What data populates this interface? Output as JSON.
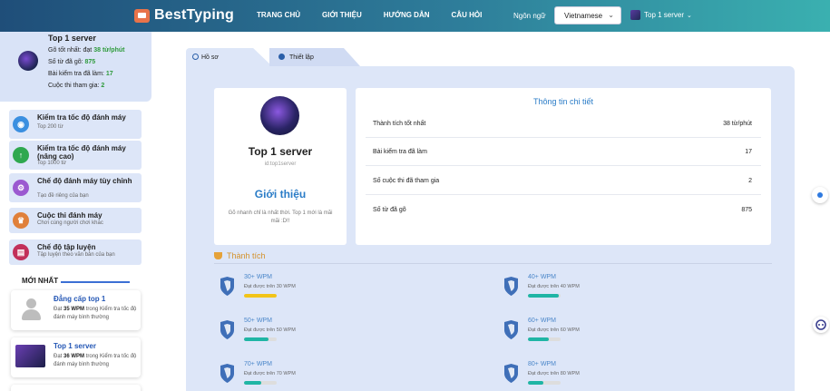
{
  "header": {
    "logo": "BestTyping",
    "nav": [
      "TRANG CHỦ",
      "GIỚI THIỆU",
      "HƯỚNG DẪN",
      "CÂU HỎI"
    ],
    "language_label": "Ngôn ngữ",
    "language_value": "Vietnamese",
    "user_name": "Top 1 server"
  },
  "sidebar": {
    "profile": {
      "name": "Top 1 server",
      "best_label": "Gõ tốt nhất: đạt",
      "best_value": "38 từ/phút",
      "words_label": "Số từ đã gõ:",
      "words_value": "875",
      "tests_label": "Bài kiểm tra đã làm:",
      "tests_value": "17",
      "contests_label": "Cuộc thi tham gia:",
      "contests_value": "2"
    },
    "menu": [
      {
        "title": "Kiểm tra tốc độ đánh máy",
        "sub": "Top 200 từ",
        "color": "#3b8fe0",
        "icon": "gauge-icon"
      },
      {
        "title": "Kiểm tra tốc độ đánh máy (nâng cao)",
        "sub": "Top 1000 từ",
        "color": "#2fa84f",
        "icon": "arrow-up-icon"
      },
      {
        "title": "Chế độ đánh máy tùy chỉnh",
        "sub": "Tạo đề riêng của bạn",
        "color": "#9b59d0",
        "icon": "gears-icon"
      },
      {
        "title": "Cuộc thi đánh máy",
        "sub": "Chơi cùng người chơi khác",
        "color": "#e0803a",
        "icon": "trophy-icon"
      },
      {
        "title": "Chế độ tập luyện",
        "sub": "Tập luyện theo văn bản của bạn",
        "color": "#c2305a",
        "icon": "keyboard-icon"
      }
    ],
    "newest_label": "MỚI NHẤT",
    "feed": [
      {
        "name": "Đẳng cấp top 1",
        "pre": "Đạt",
        "wpm": "35 WPM",
        "post": "trong Kiểm tra tốc độ đánh máy bình thường"
      },
      {
        "name": "Top 1 server",
        "pre": "Đạt",
        "wpm": "36 WPM",
        "post": "trong Kiểm tra tốc độ đánh máy bình thường"
      }
    ]
  },
  "tabs": [
    "Hồ sơ",
    "Thiết lập"
  ],
  "profile_card": {
    "name": "Top 1 server",
    "id": "id:top1server",
    "about_title": "Giới thiệu",
    "about_text": "Gõ nhanh chỉ là nhất thời. Top 1 mới là mãi mãi :D!!"
  },
  "details": {
    "title": "Thông tin chi tiết",
    "rows": [
      {
        "label": "Thành tích tốt nhất",
        "value": "38 từ/phút"
      },
      {
        "label": "Bài kiểm tra đã làm",
        "value": "17"
      },
      {
        "label": "Số cuộc thi đã tham gia",
        "value": "2"
      },
      {
        "label": "Số từ đã gõ",
        "value": "875"
      }
    ]
  },
  "achievements": {
    "title": "Thành tích",
    "items": [
      {
        "title": "30+ WPM",
        "sub": "Đạt được trên 30 WPM",
        "progress": 1.0,
        "color": "#f2c418"
      },
      {
        "title": "40+ WPM",
        "sub": "Đạt được trên 40 WPM",
        "progress": 0.95,
        "color": "#1fb5a5"
      },
      {
        "title": "50+ WPM",
        "sub": "Đạt được trên 50 WPM",
        "progress": 0.76,
        "color": "#1fb5a5"
      },
      {
        "title": "60+ WPM",
        "sub": "Đạt được trên 60 WPM",
        "progress": 0.63,
        "color": "#1fb5a5"
      },
      {
        "title": "70+ WPM",
        "sub": "Đạt được trên 70 WPM",
        "progress": 0.54,
        "color": "#1fb5a5"
      },
      {
        "title": "80+ WPM",
        "sub": "Đạt được trên 80 WPM",
        "progress": 0.48,
        "color": "#1fb5a5"
      }
    ]
  }
}
